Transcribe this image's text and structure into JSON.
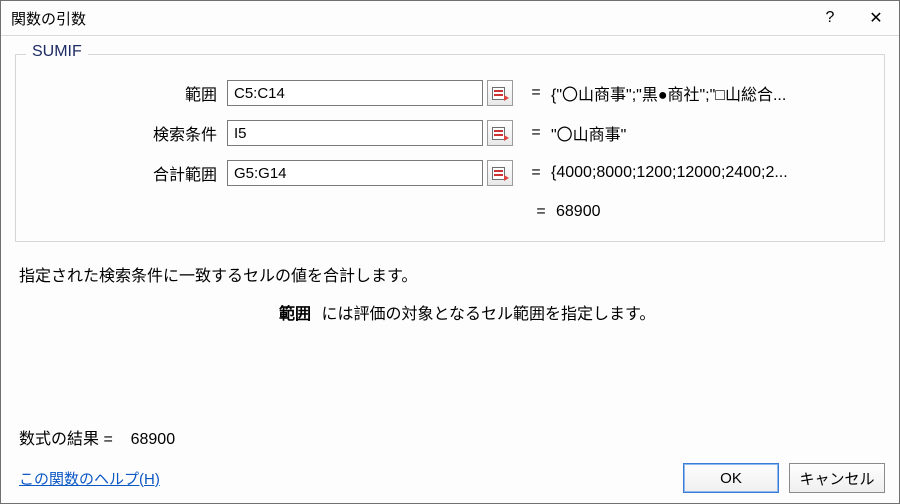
{
  "window": {
    "title": "関数の引数"
  },
  "function_name": "SUMIF",
  "args": [
    {
      "label": "範囲",
      "value": "C5:C14",
      "preview": "{\"〇山商事\";\"黒●商社\";\"□山総合..."
    },
    {
      "label": "検索条件",
      "value": "I5",
      "preview": "\"〇山商事\""
    },
    {
      "label": "合計範囲",
      "value": "G5:G14",
      "preview": "{4000;8000;1200;12000;2400;2..."
    }
  ],
  "evaluated_result": "68900",
  "description_main": "指定された検索条件に一致するセルの値を合計します。",
  "description_arg_name": "範囲",
  "description_arg_text": "には評価の対象となるセル範囲を指定します。",
  "formula_result_label": "数式の結果 =",
  "formula_result_value": "68900",
  "help_link": "この関数のヘルプ(H)",
  "buttons": {
    "ok": "OK",
    "cancel": "キャンセル"
  }
}
